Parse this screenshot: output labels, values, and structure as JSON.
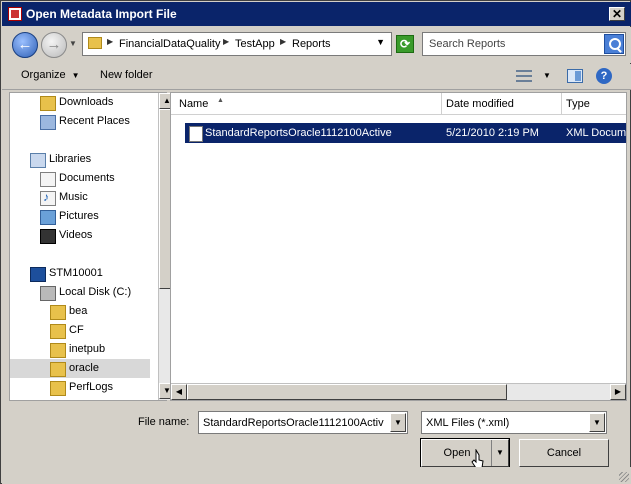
{
  "window": {
    "title": "Open Metadata Import File"
  },
  "nav": {
    "breadcrumb": [
      "FinancialDataQuality",
      "TestApp",
      "Reports"
    ],
    "search_placeholder": "Search Reports"
  },
  "toolbar": {
    "organize_label": "Organize",
    "new_folder_label": "New folder"
  },
  "sidebar": {
    "items": [
      {
        "label": "Downloads",
        "icon": "folder-icon"
      },
      {
        "label": "Recent Places",
        "icon": "recent-places-icon"
      },
      {
        "label": "Libraries",
        "icon": "libraries-icon"
      },
      {
        "label": "Documents",
        "icon": "documents-icon"
      },
      {
        "label": "Music",
        "icon": "music-icon"
      },
      {
        "label": "Pictures",
        "icon": "pictures-icon"
      },
      {
        "label": "Videos",
        "icon": "videos-icon"
      },
      {
        "label": "STM10001",
        "icon": "computer-icon"
      },
      {
        "label": "Local Disk (C:)",
        "icon": "disk-icon"
      },
      {
        "label": "bea",
        "icon": "folder-icon"
      },
      {
        "label": "CF",
        "icon": "folder-icon"
      },
      {
        "label": "inetpub",
        "icon": "folder-icon"
      },
      {
        "label": "oracle",
        "icon": "folder-icon",
        "selected": true
      },
      {
        "label": "PerfLogs",
        "icon": "folder-icon"
      }
    ]
  },
  "files": {
    "columns": [
      "Name",
      "Date modified",
      "Type"
    ],
    "rows": [
      {
        "name": "StandardReportsOracle1112100Active",
        "date": "5/21/2010 2:19 PM",
        "type": "XML Docume"
      }
    ]
  },
  "footer": {
    "file_name_label": "File name:",
    "file_name_value": "StandardReportsOracle1112100Activ",
    "file_type_value": "XML Files (*.xml)",
    "open_label": "Open",
    "cancel_label": "Cancel"
  }
}
